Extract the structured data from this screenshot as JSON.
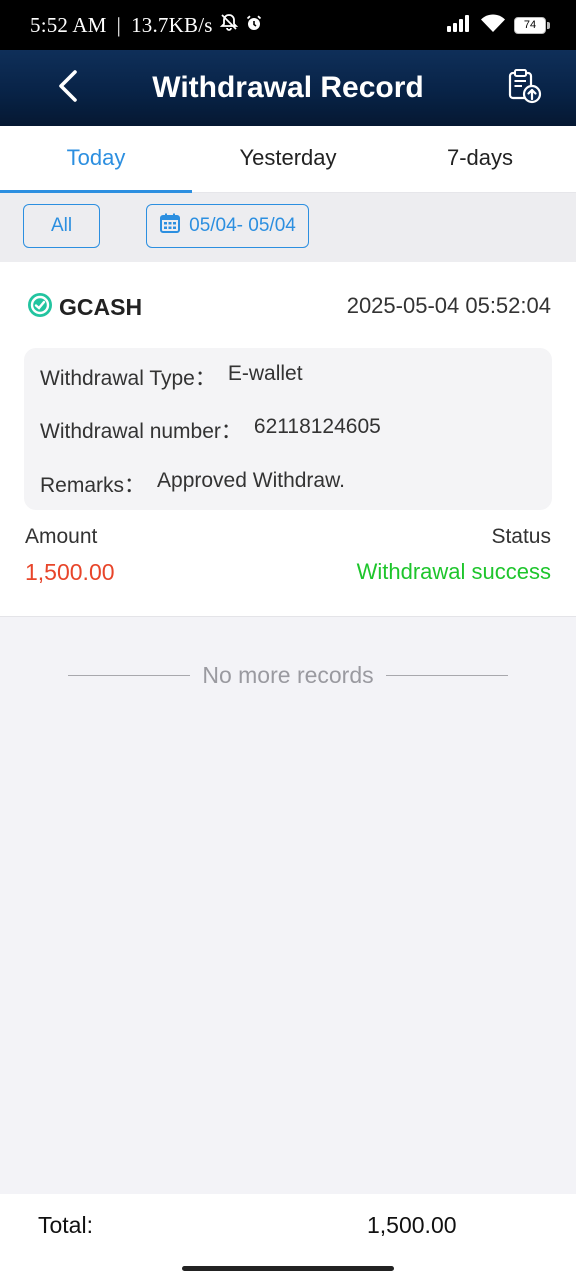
{
  "status_bar": {
    "time": "5:52 AM",
    "separator": "|",
    "net_speed": "13.7KB/s",
    "battery": "74",
    "icons": [
      "mute-bell-icon",
      "alarm-icon",
      "signal-icon",
      "wifi-icon",
      "battery-icon"
    ]
  },
  "header": {
    "title": "Withdrawal Record",
    "back_icon": "chevron-left-icon",
    "record_icon": "clipboard-upload-icon"
  },
  "tabs": [
    {
      "label": "Today",
      "active": true
    },
    {
      "label": "Yesterday",
      "active": false
    },
    {
      "label": "7-days",
      "active": false
    }
  ],
  "filters": {
    "all_label": "All",
    "date_range": "05/04- 05/04",
    "date_icon": "calendar-icon"
  },
  "record": {
    "method": "GCASH",
    "method_icon": "gcash-logo-icon",
    "time": "2025-05-04 05:52:04",
    "type_label": "Withdrawal Type：",
    "type_value": "E-wallet",
    "number_label": "Withdrawal number：",
    "number_value": "62118124605",
    "remarks_label": "Remarks：",
    "remarks_value": "Approved Withdraw.",
    "amount_label": "Amount",
    "amount_value": "1,500.00",
    "status_label": "Status",
    "status_value": "Withdrawal success"
  },
  "list_end": "No more records",
  "footer": {
    "total_label": "Total:",
    "total_value": "1,500.00"
  },
  "colors": {
    "accent": "#2c8fe0",
    "header_bg": "#082347",
    "amount": "#e8452a",
    "success": "#1ec52c",
    "gcash": "#22c4a0"
  }
}
